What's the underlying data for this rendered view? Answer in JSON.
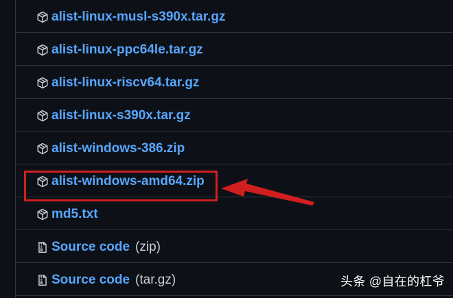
{
  "assets": [
    {
      "label": "alist-linux-musl-s390x.tar.gz",
      "icon": "package-icon"
    },
    {
      "label": "alist-linux-ppc64le.tar.gz",
      "icon": "package-icon"
    },
    {
      "label": "alist-linux-riscv64.tar.gz",
      "icon": "package-icon"
    },
    {
      "label": "alist-linux-s390x.tar.gz",
      "icon": "package-icon"
    },
    {
      "label": "alist-windows-386.zip",
      "icon": "package-icon"
    },
    {
      "label": "alist-windows-amd64.zip",
      "icon": "package-icon"
    },
    {
      "label": "md5.txt",
      "icon": "package-icon"
    },
    {
      "label": "Source code",
      "format": "(zip)",
      "icon": "file-zip-icon"
    },
    {
      "label": "Source code",
      "format": "(tar.gz)",
      "icon": "file-zip-icon"
    }
  ],
  "watermark": {
    "text": "头条 @自在的杠爷"
  },
  "colors": {
    "background": "#0d1117",
    "border": "#30363d",
    "link": "#58a6ff",
    "muted": "#c9d1d9",
    "highlight": "#d11f1f"
  }
}
